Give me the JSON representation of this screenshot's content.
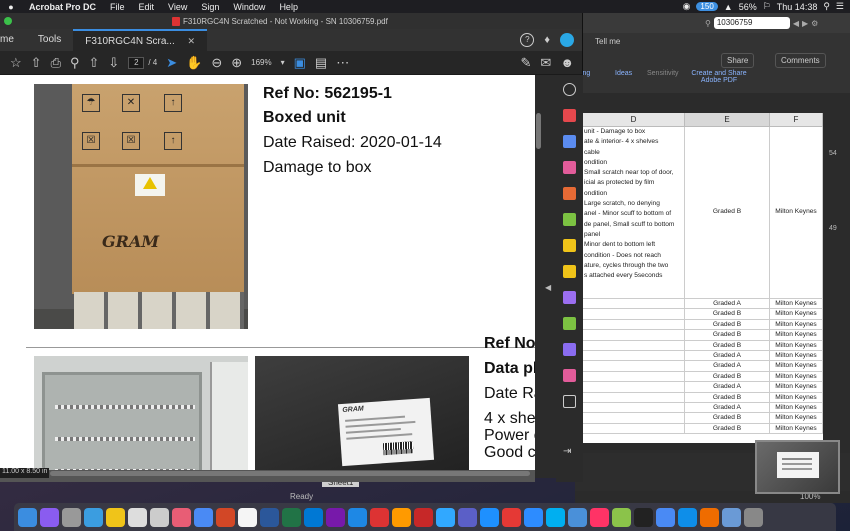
{
  "menubar": {
    "app_name": "Acrobat Pro DC",
    "menus": [
      "File",
      "Edit",
      "View",
      "Sign",
      "Window",
      "Help"
    ],
    "wifi_pill": "150",
    "battery": "56%",
    "clock": "Thu 14:38"
  },
  "excel": {
    "search_value": "10306759",
    "share_label": "Share",
    "comments_label": "Comments",
    "tell_me": "Tell me",
    "ribbon_labels": [
      "Ideas",
      "Sensitivity",
      "Create and Share Adobe PDF"
    ],
    "ribbon_cut": "ting",
    "columns": [
      "D",
      "E",
      "F"
    ],
    "big_cell_lines": [
      "unit - Damage to box",
      "ate & interior- 4 x shelves",
      "cable",
      "ondition",
      "Small scratch near top of door,",
      "icial as protected by film",
      "ondition",
      "Large scratch, no denying",
      "anel - Minor scuff to bottom of",
      "de panel, Small scuff to bottom",
      "panel",
      "Minor dent to bottom left",
      "condition - Does not reach",
      "ature, cycles through the two",
      "s attached every 5seconds"
    ],
    "big_cell_grade": "Graded B",
    "big_cell_location": "Milton Keynes",
    "rows": [
      {
        "grade": "Graded A",
        "location": "Milton Keynes"
      },
      {
        "grade": "Graded B",
        "location": "Milton Keynes"
      },
      {
        "grade": "Graded B",
        "location": "Milton Keynes"
      },
      {
        "grade": "Graded B",
        "location": "Milton Keynes"
      },
      {
        "grade": "Graded B",
        "location": "Milton Keynes"
      },
      {
        "grade": "Graded A",
        "location": "Milton Keynes"
      },
      {
        "grade": "Graded A",
        "location": "Milton Keynes"
      },
      {
        "grade": "Graded B",
        "location": "Milton Keynes"
      },
      {
        "grade": "Graded A",
        "location": "Milton Keynes"
      },
      {
        "grade": "Graded B",
        "location": "Milton Keynes"
      },
      {
        "grade": "Graded A",
        "location": "Milton Keynes"
      },
      {
        "grade": "Graded B",
        "location": "Milton Keynes"
      },
      {
        "grade": "Graded B",
        "location": "Milton Keynes"
      }
    ],
    "side_numbers": [
      "54",
      "49"
    ],
    "sheet_tab": "Sheet1",
    "status": "Ready",
    "zoom": "100%"
  },
  "acrobat": {
    "window_title": "F310RGC4N Scratched - Not Working - SN 10306759.pdf",
    "tabs": {
      "home": "me",
      "tools": "Tools",
      "document": "F310RGC4N Scra..."
    },
    "page_current": "2",
    "page_total": "/ 4",
    "zoom": "169%",
    "doc_size": "11.00 x 8.50 in"
  },
  "page": {
    "ref1": "Ref No: 562195-1",
    "unit_type": "Boxed unit",
    "date_raised": "Date Raised: 2020-01-14",
    "damage": "Damage to box",
    "ref2": "Ref No",
    "data_plate": "Data pl",
    "date_raised_2": "Date Ra",
    "shelves": "4 x she",
    "power": "Power c",
    "condition": "Good co",
    "box_brand": "GRAM",
    "plate_brand": "GRAM"
  },
  "dock": {
    "apps": [
      "Finder",
      "Siri",
      "Launchpad",
      "Safari",
      "Notes",
      "Notes2",
      "Files",
      "Photos",
      "Chrome",
      "PowerPoint",
      "Calendar",
      "Word",
      "Excel",
      "Outlook",
      "OneNote",
      "AppStore",
      "Acrobat",
      "Illustrator",
      "PDF",
      "Photoshop",
      "Teams",
      "Xcode",
      "Block",
      "Zoom",
      "Skype",
      "Preview",
      "InDesign",
      "Preview2",
      "Terminal",
      "Chrome2",
      "TeamViewer",
      "Sync",
      "Downloads",
      "Trash"
    ]
  },
  "colors": {
    "accent": "#3b8de0",
    "excel_green": "#1d6f42",
    "acrobat_red": "#d33"
  }
}
